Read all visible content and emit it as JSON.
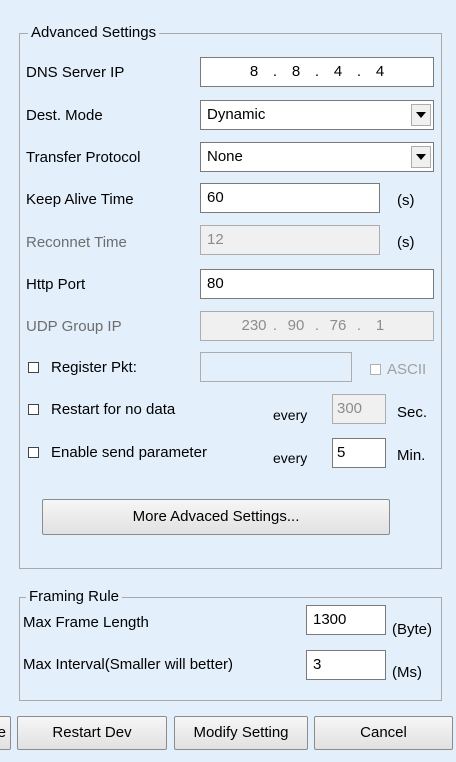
{
  "advanced": {
    "legend": "Advanced Settings",
    "dns_label": "DNS Server IP",
    "dns_ip": [
      "8",
      "8",
      "4",
      "4"
    ],
    "dest_mode_label": "Dest. Mode",
    "dest_mode_value": "Dynamic",
    "transfer_label": "Transfer Protocol",
    "transfer_value": "None",
    "keepalive_label": "Keep Alive Time",
    "keepalive_value": "60",
    "keepalive_unit": "(s)",
    "reconnet_label": "Reconnet Time",
    "reconnet_value": "12",
    "reconnet_unit": "(s)",
    "http_label": "Http Port",
    "http_value": "80",
    "udp_label": "UDP Group IP",
    "udp_ip": [
      "230",
      "90",
      "76",
      "1"
    ],
    "register_label": "Register Pkt:",
    "register_value": "",
    "ascii_label": "ASCII",
    "restart_label": "Restart for no data",
    "restart_every": "every",
    "restart_value": "300",
    "restart_unit": "Sec.",
    "send_label": "Enable send parameter",
    "send_every": "every",
    "send_value": "5",
    "send_unit": "Min.",
    "more_button": "More Advaced Settings..."
  },
  "framing": {
    "legend": "Framing Rule",
    "max_frame_label": "Max Frame Length",
    "max_frame_value": "1300",
    "max_frame_unit": "(Byte)",
    "max_interval_label": "Max Interval(Smaller will better)",
    "max_interval_value": "3",
    "max_interval_unit": "(Ms)"
  },
  "footer": {
    "cut_button": "e",
    "restart_button": "Restart Dev",
    "modify_button": "Modify Setting",
    "cancel_button": "Cancel"
  }
}
